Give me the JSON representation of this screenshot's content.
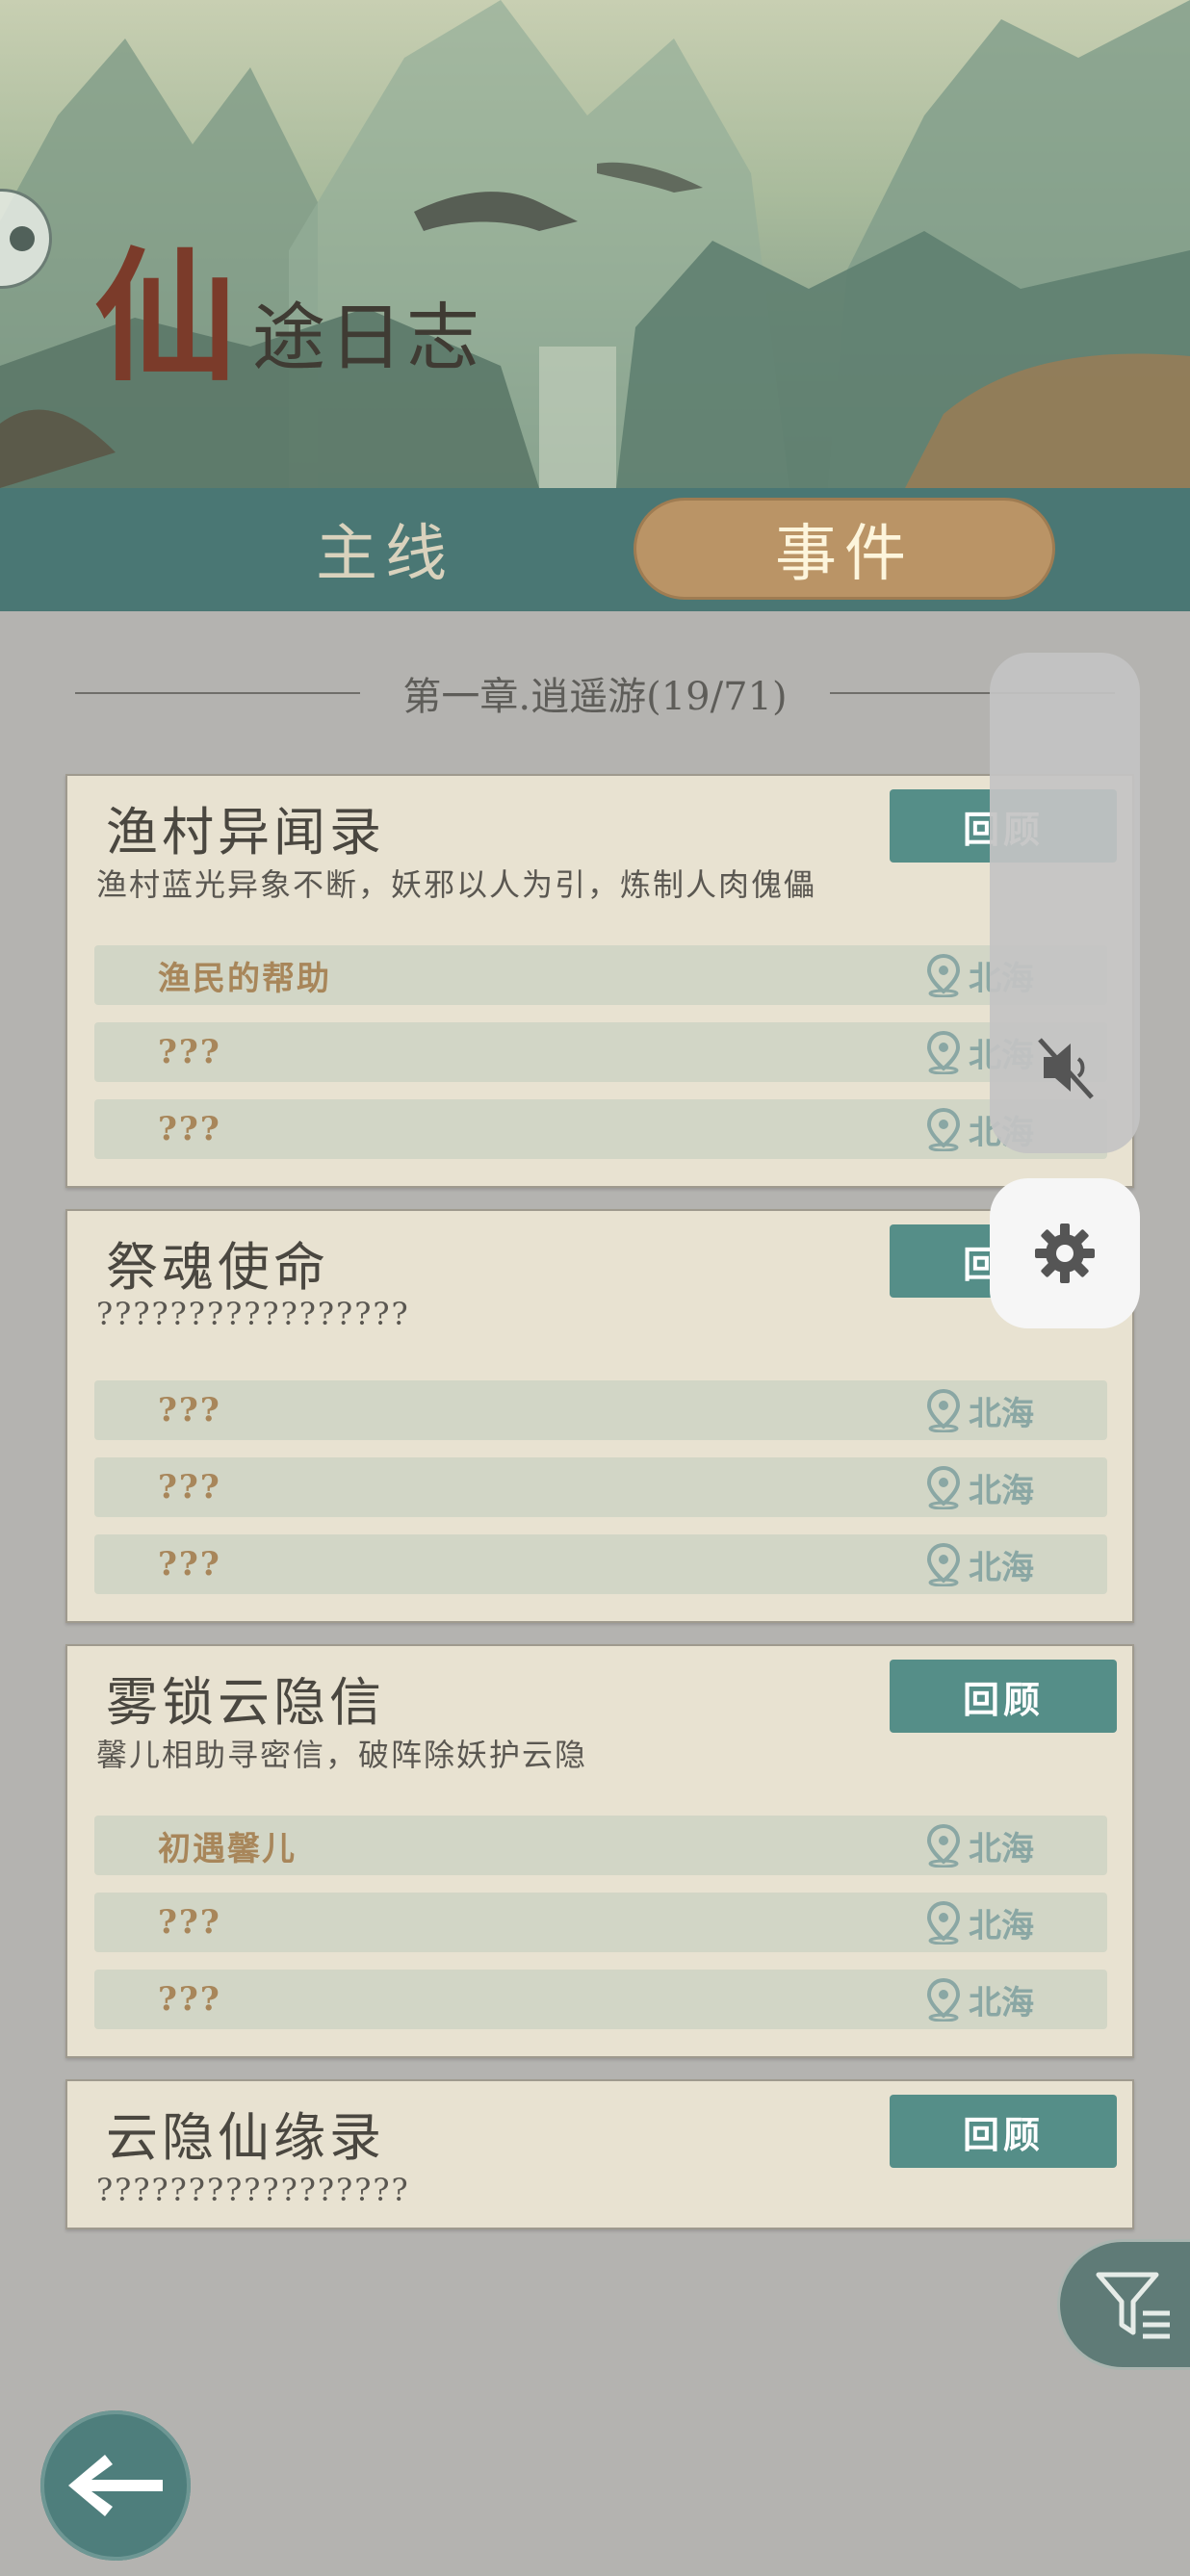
{
  "banner": {
    "title_big": "仙",
    "title_rest": "途日志"
  },
  "tabs": [
    {
      "label": "主线",
      "active": false
    },
    {
      "label": "事件",
      "active": true
    }
  ],
  "chapter": {
    "label": "第一章.逍遥游(19/71)"
  },
  "review_label": "回顾",
  "cards": [
    {
      "title": "渔村异闻录",
      "desc": "渔村蓝光异象不断，妖邪以人为引，炼制人肉傀儡",
      "rows": [
        {
          "name": "渔民的帮助",
          "loc": "北海"
        },
        {
          "name": "???",
          "loc": "北海"
        },
        {
          "name": "???",
          "loc": "北海"
        }
      ]
    },
    {
      "title": "祭魂使命",
      "desc": "?????????????????",
      "rows": [
        {
          "name": "???",
          "loc": "北海"
        },
        {
          "name": "???",
          "loc": "北海"
        },
        {
          "name": "???",
          "loc": "北海"
        }
      ]
    },
    {
      "title": "雾锁云隐信",
      "desc": "馨儿相助寻密信，破阵除妖护云隐",
      "rows": [
        {
          "name": "初遇馨儿",
          "loc": "北海"
        },
        {
          "name": "???",
          "loc": "北海"
        },
        {
          "name": "???",
          "loc": "北海"
        }
      ]
    },
    {
      "title": "云隐仙缘录",
      "desc": "?????????????????",
      "rows": []
    }
  ],
  "icons": {
    "location": "location-pin-icon",
    "mute": "volume-mute-icon",
    "settings": "gear-icon",
    "filter": "filter-icon",
    "back": "back-arrow-icon"
  },
  "colors": {
    "tab_bar": "#4a7774",
    "active_tab": "#ba9466",
    "review_button": "#558e88",
    "card_bg": "#e8e2d1",
    "row_bg": "#d2d6c6",
    "event_name": "#a8865a",
    "location_text": "#8aa7a4"
  }
}
